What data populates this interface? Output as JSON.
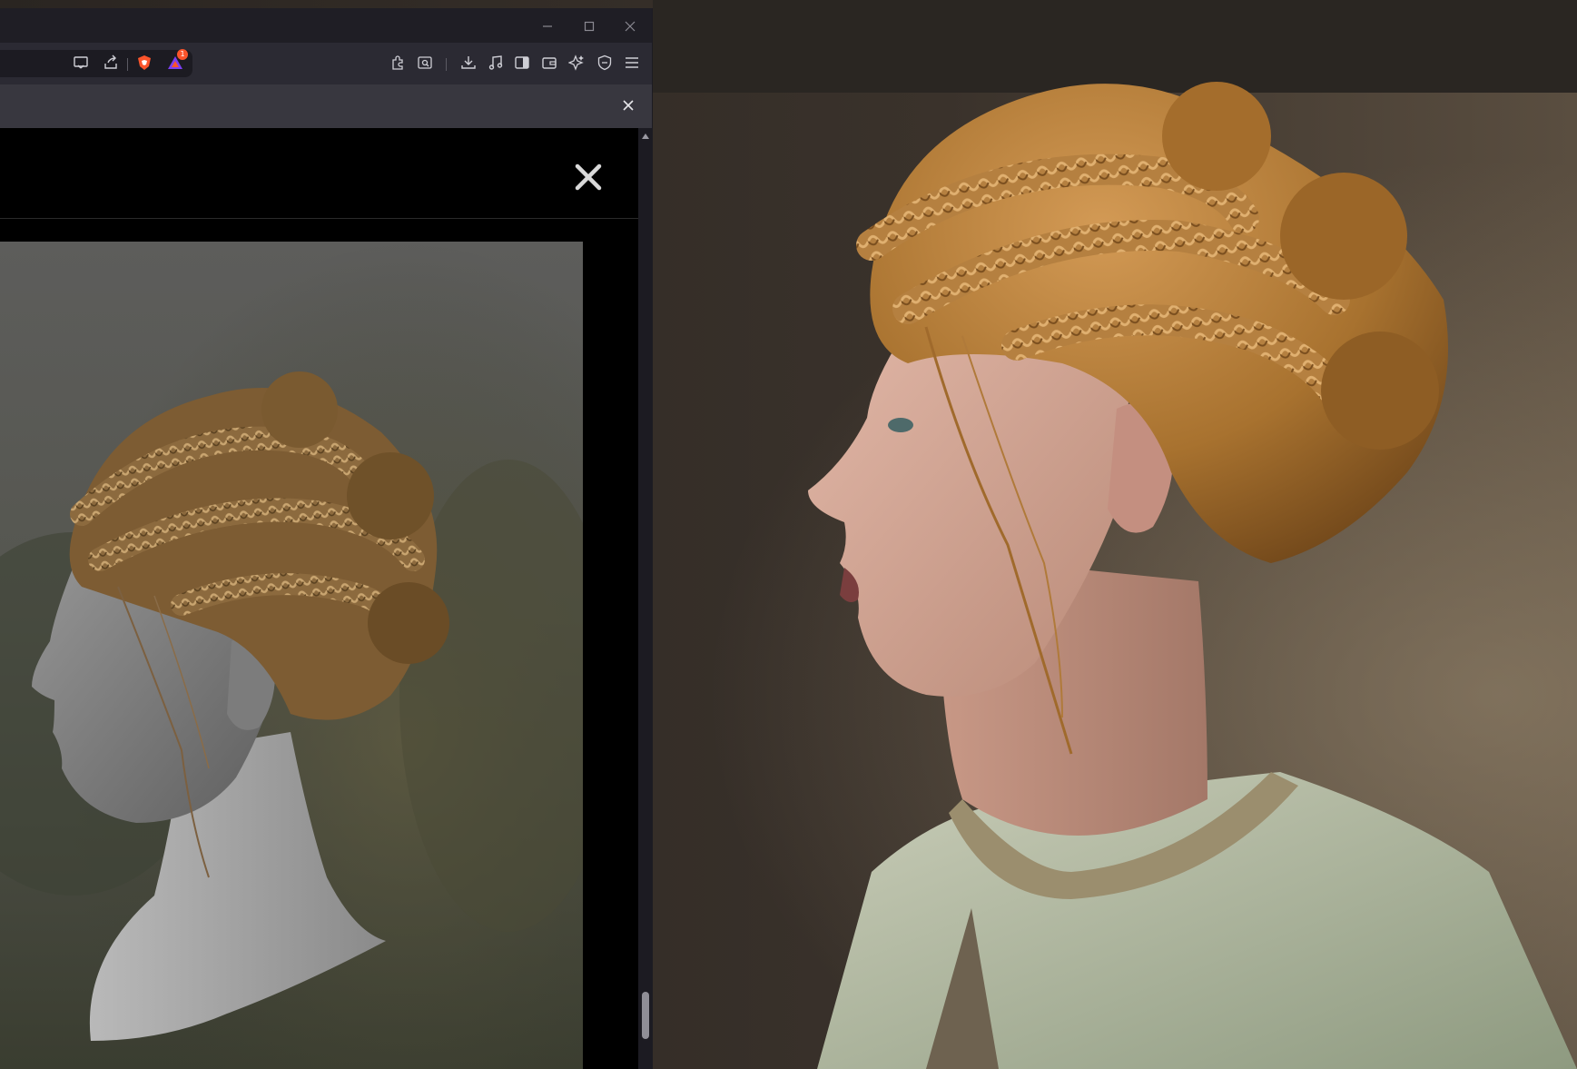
{
  "window": {
    "controls": [
      "minimize-icon",
      "maximize-icon",
      "close-icon"
    ]
  },
  "toolbar": {
    "icons_left": [
      "cast-icon",
      "share-icon",
      "brave-shield-icon",
      "brave-rewards-icon"
    ],
    "rewards_badge": "1",
    "icons_right": [
      "extensions-icon",
      "tab-search-icon",
      "download-icon",
      "media-icon",
      "sidebar-icon",
      "wallet-icon",
      "leo-ai-icon",
      "vpn-icon",
      "menu-icon"
    ]
  },
  "colors": {
    "chrome_dark": "#1f1e25",
    "chrome": "#2b2a33",
    "infobar": "#38373f",
    "brave_orange": "#fb542b",
    "rewards_purple": "#7b3ff2",
    "hair_blonde": "#b07a3a",
    "skin": "#d6a99a",
    "tunic": "#b9bfa9"
  }
}
